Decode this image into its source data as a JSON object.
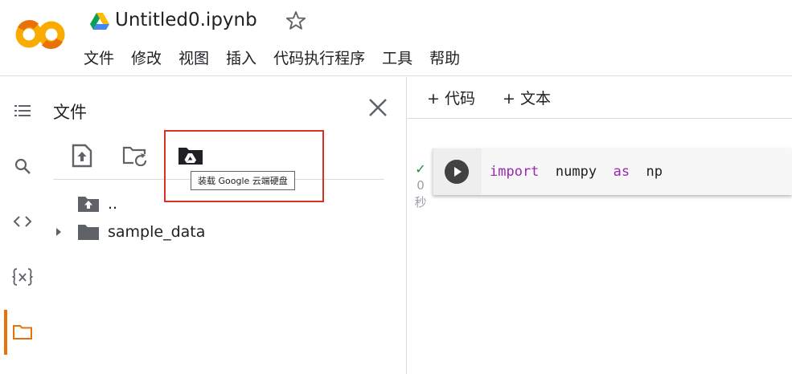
{
  "app": {
    "title": "Untitled0.ipynb",
    "menu": [
      "文件",
      "修改",
      "视图",
      "插入",
      "代码执行程序",
      "工具",
      "帮助"
    ]
  },
  "rail": {
    "icons": [
      "toc-icon",
      "search-icon",
      "code-snippets-icon",
      "variables-icon",
      "folder-icon"
    ],
    "active_color": "#e8710a"
  },
  "files_panel": {
    "title": "文件",
    "toolbar": [
      "upload-file-icon",
      "refresh-folder-icon",
      "mount-drive-icon"
    ],
    "tooltip": "装载 Google 云端硬盘",
    "tree": [
      {
        "label": ".."
      },
      {
        "label": "sample_data"
      }
    ]
  },
  "notebook": {
    "add_code": "+ 代码",
    "add_text": "+ 文本",
    "cell": {
      "exec_check": "✓",
      "exec_time": "0",
      "exec_unit": "秒",
      "code_tokens": [
        {
          "text": "import",
          "kind": "keyword"
        },
        {
          "text": "numpy",
          "kind": "name"
        },
        {
          "text": "as",
          "kind": "keyword"
        },
        {
          "text": "np",
          "kind": "name"
        }
      ]
    }
  },
  "colors": {
    "keyword": "#9c27b0",
    "highlight": "#d93025",
    "logo": "#f9ab00"
  }
}
